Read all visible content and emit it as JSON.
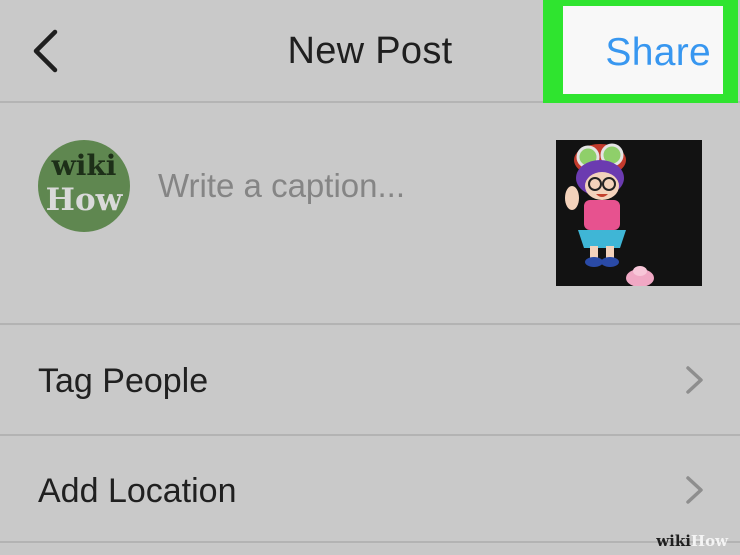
{
  "header": {
    "title": "New Post",
    "share_label": "Share",
    "share_highlight_color": "#2fe42f",
    "back_icon": "chevron-left-icon"
  },
  "caption": {
    "avatar_text_top": "wiki",
    "avatar_text_bottom": "How",
    "placeholder": "Write a caption...",
    "value": ""
  },
  "options": [
    {
      "label": "Tag People",
      "icon": "chevron-right-icon"
    },
    {
      "label": "Add Location",
      "icon": "chevron-right-icon"
    }
  ],
  "watermark": {
    "part1": "wiki",
    "part2": "How"
  },
  "colors": {
    "accent": "#3897f0",
    "background": "#c9c9c9"
  }
}
